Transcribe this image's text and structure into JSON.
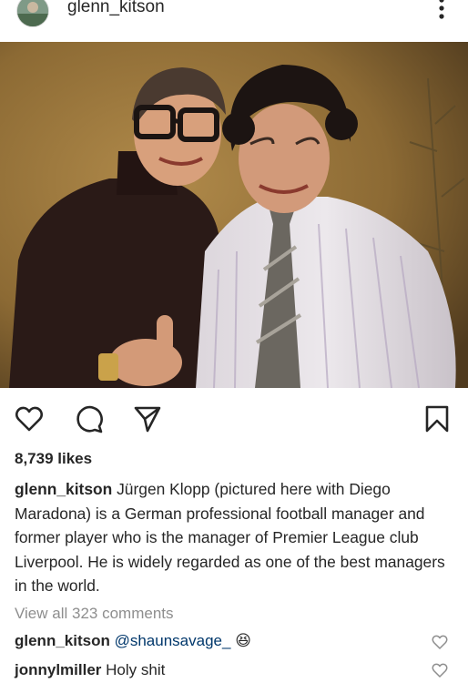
{
  "post": {
    "username": "glenn_kitson",
    "likes": "8,739 likes",
    "caption": {
      "username": "glenn_kitson",
      "text": "Jürgen Klopp (pictured here with Diego Maradona) is a German professional football manager and former player who is the manager of Premier League club Liverpool. He is widely regarded as one of the best managers in the world."
    },
    "view_all_comments": "View all 323 comments"
  },
  "comments": [
    {
      "username": "glenn_kitson",
      "mention": "@shaunsavage_",
      "emoji": "😆"
    },
    {
      "username": "jonnylmiller",
      "text": "Holy shit"
    }
  ],
  "icons": {
    "more": "more-options-icon",
    "like": "heart-icon",
    "comment": "comment-bubble-icon",
    "share": "paper-plane-icon",
    "save": "bookmark-icon",
    "comment_like": "small-heart-icon"
  },
  "colors": {
    "text": "#262626",
    "muted": "#8e8e8e",
    "mention": "#00376b",
    "icon": "#262626"
  }
}
